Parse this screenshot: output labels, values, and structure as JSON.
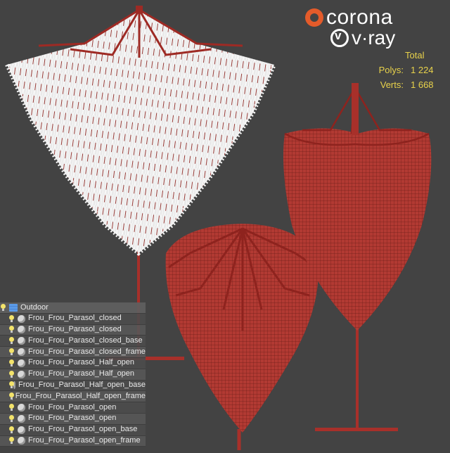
{
  "logos": {
    "corona": "corona",
    "vray": "v·ray",
    "vray_mark": "v"
  },
  "colors": {
    "background": "#434343",
    "model": "#b03a32",
    "stats_text": "#e8d24b",
    "corona_brand": "#e45b2a"
  },
  "stats": {
    "header": "Total",
    "polys_label": "Polys:",
    "polys_value": "1 224",
    "verts_label": "Verts:",
    "verts_value": "1 668"
  },
  "layers": {
    "group": {
      "label": "Outdoor",
      "icon": "layer-stack-icon"
    },
    "items": [
      {
        "label": "Frou_Frou_Parasol_closed",
        "icon": "group-object-icon"
      },
      {
        "label": "Frou_Frou_Parasol_closed",
        "icon": "sphere-object-icon"
      },
      {
        "label": "Frou_Frou_Parasol_closed_base",
        "icon": "sphere-object-icon"
      },
      {
        "label": "Frou_Frou_Parasol_closed_frame",
        "icon": "sphere-object-icon"
      },
      {
        "label": "Frou_Frou_Parasol_Half_open",
        "icon": "sphere-object-icon"
      },
      {
        "label": "Frou_Frou_Parasol_Half_open",
        "icon": "group-object-icon"
      },
      {
        "label": "Frou_Frou_Parasol_Half_open_base",
        "icon": "sphere-object-icon"
      },
      {
        "label": "Frou_Frou_Parasol_Half_open_frame",
        "icon": "sphere-object-icon"
      },
      {
        "label": "Frou_Frou_Parasol_open",
        "icon": "group-object-icon"
      },
      {
        "label": "Frou_Frou_Parasol_open",
        "icon": "sphere-object-icon"
      },
      {
        "label": "Frou_Frou_Parasol_open_base",
        "icon": "sphere-object-icon"
      },
      {
        "label": "Frou_Frou_Parasol_open_frame",
        "icon": "sphere-object-icon"
      }
    ]
  }
}
